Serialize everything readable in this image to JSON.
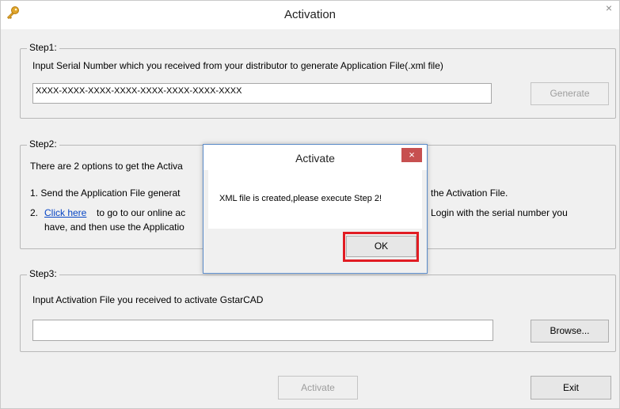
{
  "window": {
    "title": "Activation",
    "close_glyph": "×",
    "icon": "key-icon"
  },
  "step1": {
    "legend": "Step1:",
    "instruction": "Input Serial Number which you received from your distributor to generate Application File(.xml file)",
    "serial_value": "XXXX-XXXX-XXXX-XXXX-XXXX-XXXX-XXXX-XXXX",
    "generate_label": "Generate"
  },
  "step2": {
    "legend": "Step2:",
    "intro": "There are 2 options to get the Activa",
    "option1_prefix": "1.  Send the Application File generat",
    "option1_suffix": "the Activation File.",
    "option2_prefix": "2.",
    "option2_link": "Click here",
    "option2_mid": " to go to our online ac",
    "option2_suffix": "Login with the serial number you",
    "option2_line2": "have, and then use the Applicatio"
  },
  "step3": {
    "legend": "Step3:",
    "instruction": "Input Activation File you received to activate GstarCAD",
    "file_value": "",
    "browse_label": "Browse..."
  },
  "footer": {
    "activate_label": "Activate",
    "exit_label": "Exit"
  },
  "dialog": {
    "title": "Activate",
    "close_glyph": "×",
    "message": "XML file is created,please execute Step 2!",
    "ok_label": "OK",
    "highlight_color": "#e11c23"
  }
}
